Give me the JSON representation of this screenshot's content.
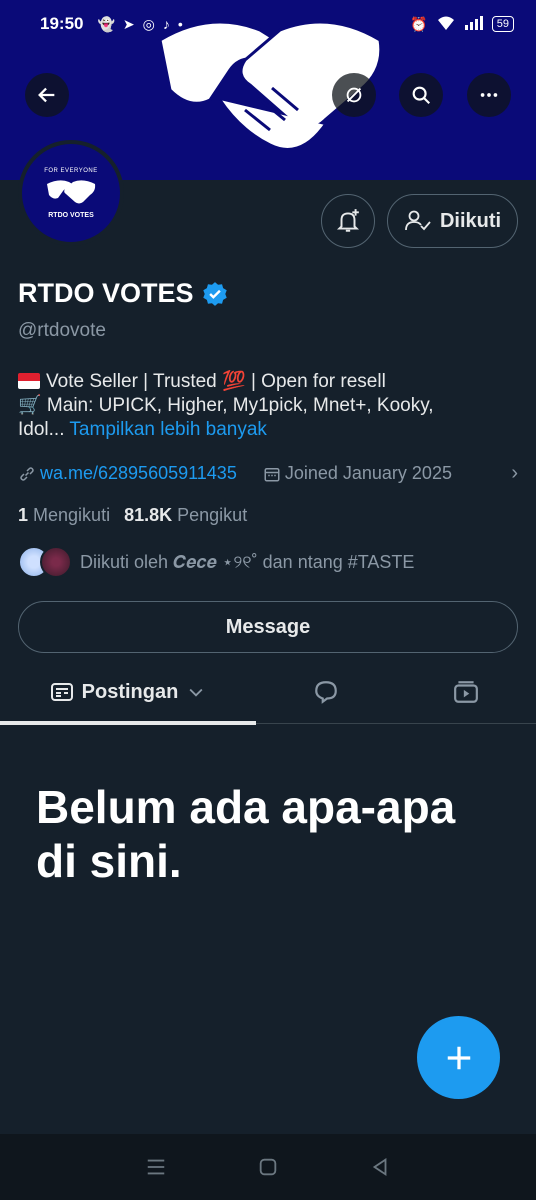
{
  "status_bar": {
    "time": "19:50",
    "battery": "59"
  },
  "profile": {
    "name": "RTDO VOTES",
    "handle": "@rtdovote",
    "avatar_top_text": "FOR EVERYONE",
    "avatar_bottom_text": "RTDO VOTES",
    "follow_button": "Diikuti",
    "bio_line1": "Vote Seller | Trusted 💯 | Open for resell",
    "bio_line2": "🛒 Main: UPICK, Higher, My1pick, Mnet+, Kooky,",
    "bio_line3": "Idol...",
    "bio_more": "Tampilkan lebih banyak",
    "link": "wa.me/62895605911435",
    "joined": "Joined January 2025",
    "following_count": "1",
    "following_label": "Mengikuti",
    "followers_count": "81.8K",
    "followers_label": "Pengikut",
    "followed_by": "Diikuti oleh 𝑪𝒆𝒄𝒆 ⋆୨୧˚ dan ntang #TASTE",
    "message_button": "Message"
  },
  "tabs": {
    "posts_label": "Postingan"
  },
  "empty_state": "Belum ada apa-apa di sini.",
  "colors": {
    "banner": "#0a0a78",
    "accent": "#1d9bf0",
    "background": "#15202b"
  }
}
